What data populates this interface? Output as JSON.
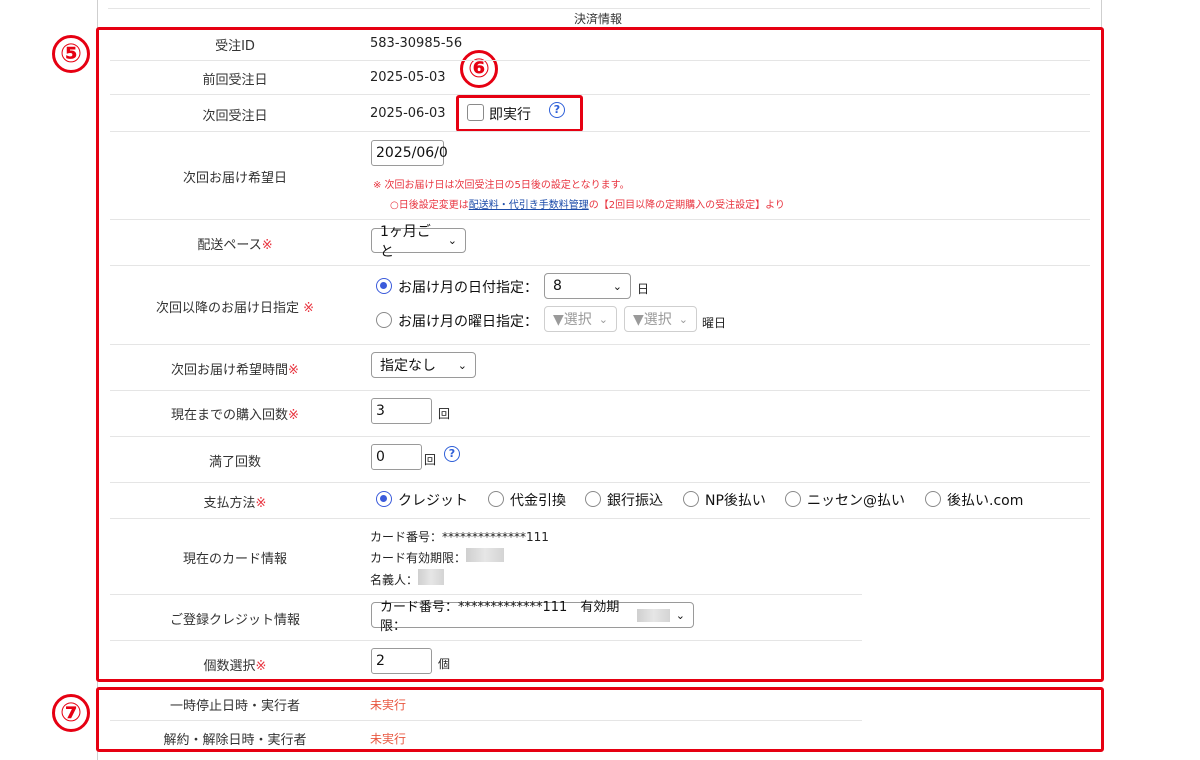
{
  "section_title": "決済情報",
  "markers": {
    "five": "⑤",
    "six": "⑥",
    "seven": "⑦"
  },
  "rows": {
    "order_id": {
      "label": "受注ID",
      "value": "583-30985-56"
    },
    "prev_order_date": {
      "label": "前回受注日",
      "value": "2025-05-03"
    },
    "next_order_date": {
      "label": "次回受注日",
      "value": "2025-06-03",
      "immediate_label": "即実行"
    },
    "next_delivery_date": {
      "label": "次回お届け希望日",
      "value": "2025/06/0",
      "note1": "※ 次回お届け日は次回受注日の5日後の設定となります。",
      "note2_prefix": "○日後設定変更は",
      "note2_link": "配送料・代引き手数料管理",
      "note2_suffix": "の【2回目以降の定期購入の受注設定】より"
    },
    "delivery_pace": {
      "label": "配送ペース",
      "required": "※",
      "selected": "1ヶ月ごと"
    },
    "delivery_day": {
      "label": "次回以降のお届け日指定",
      "required": "※",
      "opt1_label": "お届け月の日付指定：",
      "opt1_value": "8",
      "opt1_unit": "日",
      "opt2_label": "お届け月の曜日指定：",
      "opt2_select1": "▼選択",
      "opt2_select2": "▼選択",
      "opt2_unit": "曜日"
    },
    "delivery_time": {
      "label": "次回お届け希望時間",
      "required": "※",
      "selected": "指定なし"
    },
    "purchase_count": {
      "label": "現在までの購入回数",
      "required": "※",
      "value": "3",
      "unit": "回"
    },
    "completion_count": {
      "label": "満了回数",
      "value": "0",
      "unit": "回"
    },
    "payment_method": {
      "label": "支払方法",
      "required": "※",
      "options": [
        "クレジット",
        "代金引換",
        "銀行振込",
        "NP後払い",
        "ニッセン@払い",
        "後払い.com"
      ]
    },
    "current_card": {
      "label": "現在のカード情報",
      "card_number": "カード番号：**************111",
      "expiry": "カード有効期限：",
      "holder": "名義人："
    },
    "registered_credit": {
      "label": "ご登録クレジット情報",
      "selected": "カード番号：*************111　有効期限："
    },
    "quantity": {
      "label": "個数選択",
      "required": "※",
      "value": "2",
      "unit": "個"
    },
    "pause": {
      "label": "一時停止日時・実行者",
      "value": "未実行"
    },
    "cancel": {
      "label": "解約・解除日時・実行者",
      "value": "未実行"
    }
  },
  "colors": {
    "accent_red": "#e60012",
    "required_red": "#e8343f",
    "link_blue": "#1a4aa8",
    "radio_blue": "#3b5bdb",
    "status_red": "#e8563f"
  }
}
